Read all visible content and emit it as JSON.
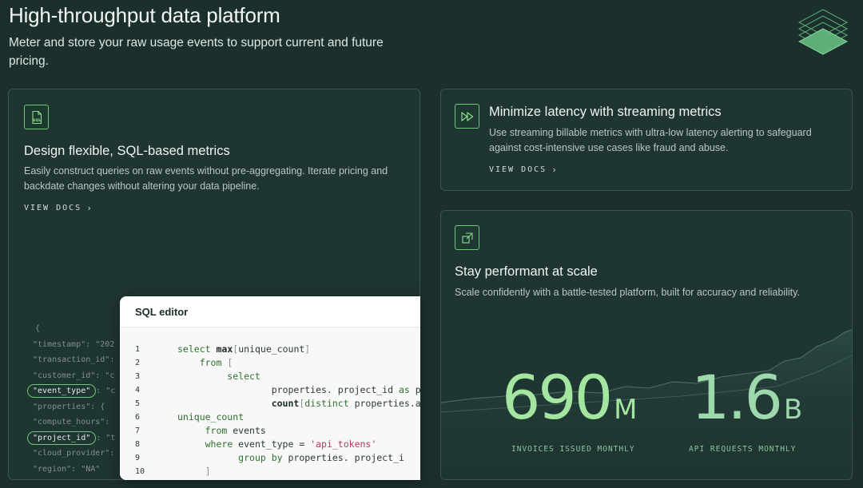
{
  "hero": {
    "title": "High-throughput data platform",
    "subtitle": "Meter and store your raw usage events to support current and future pricing."
  },
  "cards": {
    "sql_metrics": {
      "icon": "sql-file-icon",
      "title": "Design flexible, SQL-based metrics",
      "body": "Easily construct queries on raw events without pre-aggregating. Iterate pricing and backdate changes without altering your data pipeline.",
      "link": "VIEW DOCS",
      "icon_text": "SQL"
    },
    "streaming": {
      "icon": "fast-forward-icon",
      "title": "Minimize latency with streaming metrics",
      "body": "Use streaming billable metrics with ultra-low latency alerting to safeguard against cost-intensive use cases like fraud and abuse.",
      "link": "VIEW DOCS"
    },
    "scale": {
      "icon": "expand-icon",
      "title": "Stay performant at scale",
      "body": "Scale confidently with a battle-tested platform, built for accuracy and reliability."
    }
  },
  "json_preview": [
    "{",
    "\"timestamp\": \"202",
    "\"transaction_id\":",
    "\"customer_id\": \"c",
    "\"event_type\": \"c",
    "\"properties\": {",
    "\"compute_hours\":",
    "\"project_id\": \"t",
    "\"cloud_provider\":",
    "\"region\": \"NA\"",
    "}"
  ],
  "json_highlight_keys": [
    "\"event_type\"",
    "\"project_id\""
  ],
  "sql_editor": {
    "title": "SQL editor",
    "line_numbers": [
      "1",
      "2",
      "3",
      "4",
      "5",
      "6",
      "7",
      "8",
      "9",
      "10"
    ]
  },
  "metrics": [
    {
      "value": "690",
      "unit": "M",
      "label": "INVOICES ISSUED MONTHLY"
    },
    {
      "value": "1.6",
      "unit": "B",
      "label": "API REQUESTS MONTHLY"
    }
  ],
  "colors": {
    "background": "#1b302d",
    "card": "#1f3532",
    "accent_green": "#6fc67a",
    "metric_gradient_start": "#b7f0a4",
    "metric_gradient_end": "#8ed49c"
  }
}
